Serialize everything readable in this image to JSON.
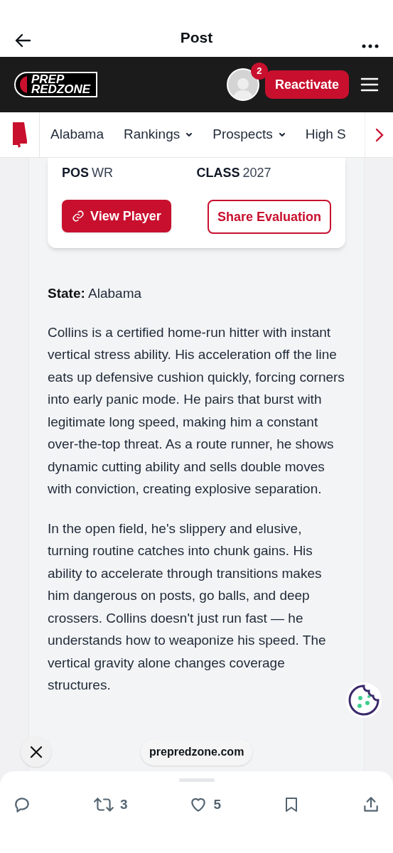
{
  "top_bar": {
    "title": "Post"
  },
  "header": {
    "logo": [
      "PREP",
      "REDZONE"
    ],
    "notification_count": "2",
    "button": "Reactivate"
  },
  "nav": {
    "items": [
      {
        "label": "Alabama",
        "kind": "link"
      },
      {
        "label": "Rankings",
        "kind": "dropdown"
      },
      {
        "label": "Prospects",
        "kind": "dropdown"
      },
      {
        "label": "High S",
        "kind": "link"
      }
    ]
  },
  "player_card": {
    "fields": [
      {
        "label": "POS",
        "value": "WR"
      },
      {
        "label": "CLASS",
        "value": "2027"
      }
    ],
    "primary_button": "View Player",
    "secondary_button": "Share Evaluation"
  },
  "article": {
    "state_label": "State:",
    "state_value": "Alabama",
    "paragraphs": [
      "Collins is a certified home-run hitter with instant vertical stress ability. His acceleration off the line eats up defensive cushion quickly, forcing corners into early panic mode. He pairs that burst with legitimate long speed, making him a constant over-the-top threat. As a route runner, he shows dynamic cutting ability and sells double moves with conviction, creating explosive separation.",
      "In the open field, he's slippery and elusive, turning routine catches into chunk gains. His ability to accelerate through transitions makes him dangerous on posts, go balls, and deep crossers. Collins doesn't just run fast — he understands how to weaponize his speed. The vertical gravity alone changes coverage structures."
    ]
  },
  "browser_overlay": {
    "url": "prepredzone.com"
  },
  "actions": [
    {
      "kind": "reply"
    },
    {
      "kind": "repost",
      "count": "3"
    },
    {
      "kind": "like",
      "count": "5"
    },
    {
      "kind": "bookmark"
    },
    {
      "kind": "share"
    }
  ]
}
